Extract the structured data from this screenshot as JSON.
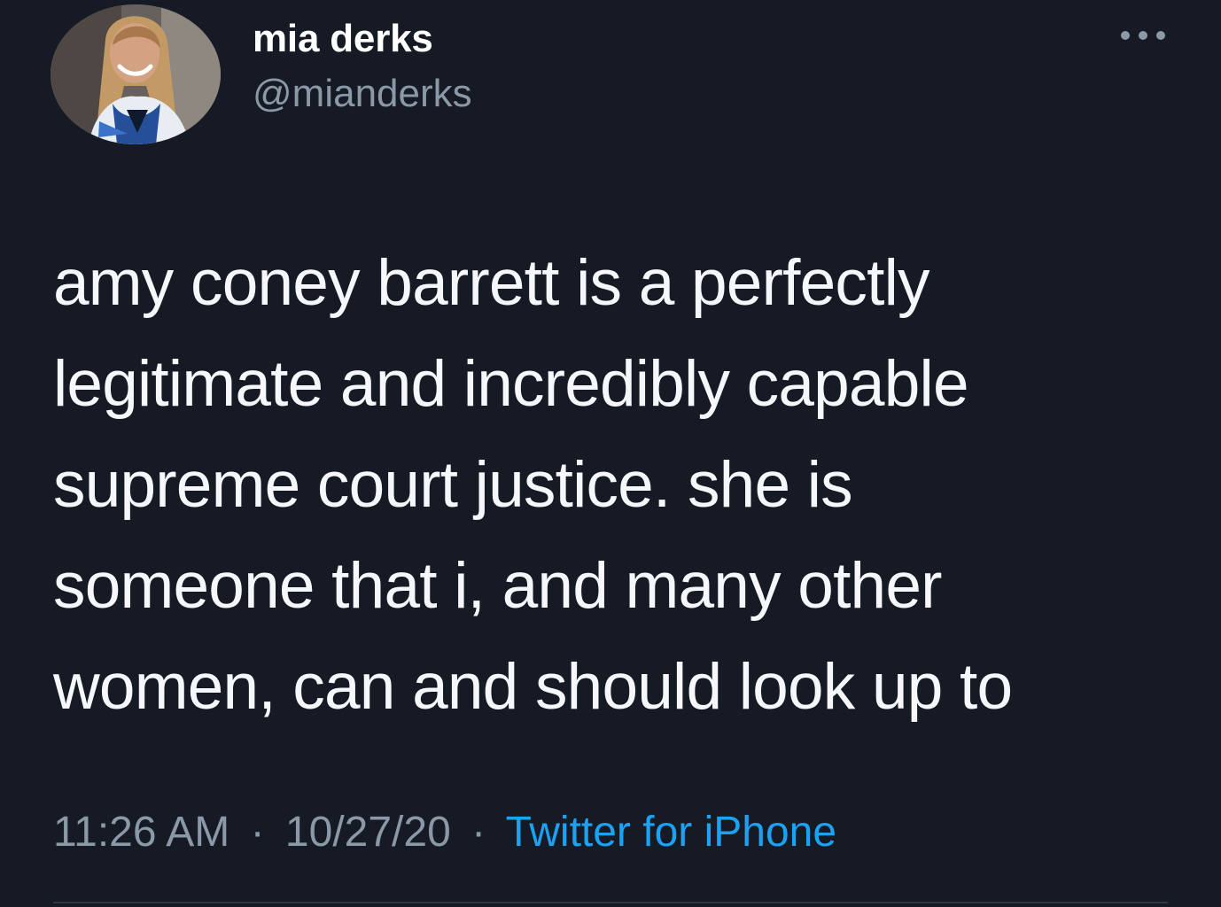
{
  "author": {
    "display_name": "mia derks",
    "handle": "@mianderks"
  },
  "tweet": {
    "lines": [
      "amy coney barrett is a perfectly",
      "legitimate and incredibly capable",
      "supreme court justice. she is",
      "someone that i, and many other",
      "women, can and should look up to"
    ]
  },
  "meta": {
    "time": "11:26 AM",
    "separator": "·",
    "date": "10/27/20",
    "source": "Twitter for iPhone"
  },
  "icons": {
    "more": "more-horizontal-icon"
  },
  "colors": {
    "background": "#151a24",
    "text": "#f5f7fa",
    "secondary_text": "#8a98a8",
    "link": "#1da1f2",
    "divider": "#2f3640"
  }
}
